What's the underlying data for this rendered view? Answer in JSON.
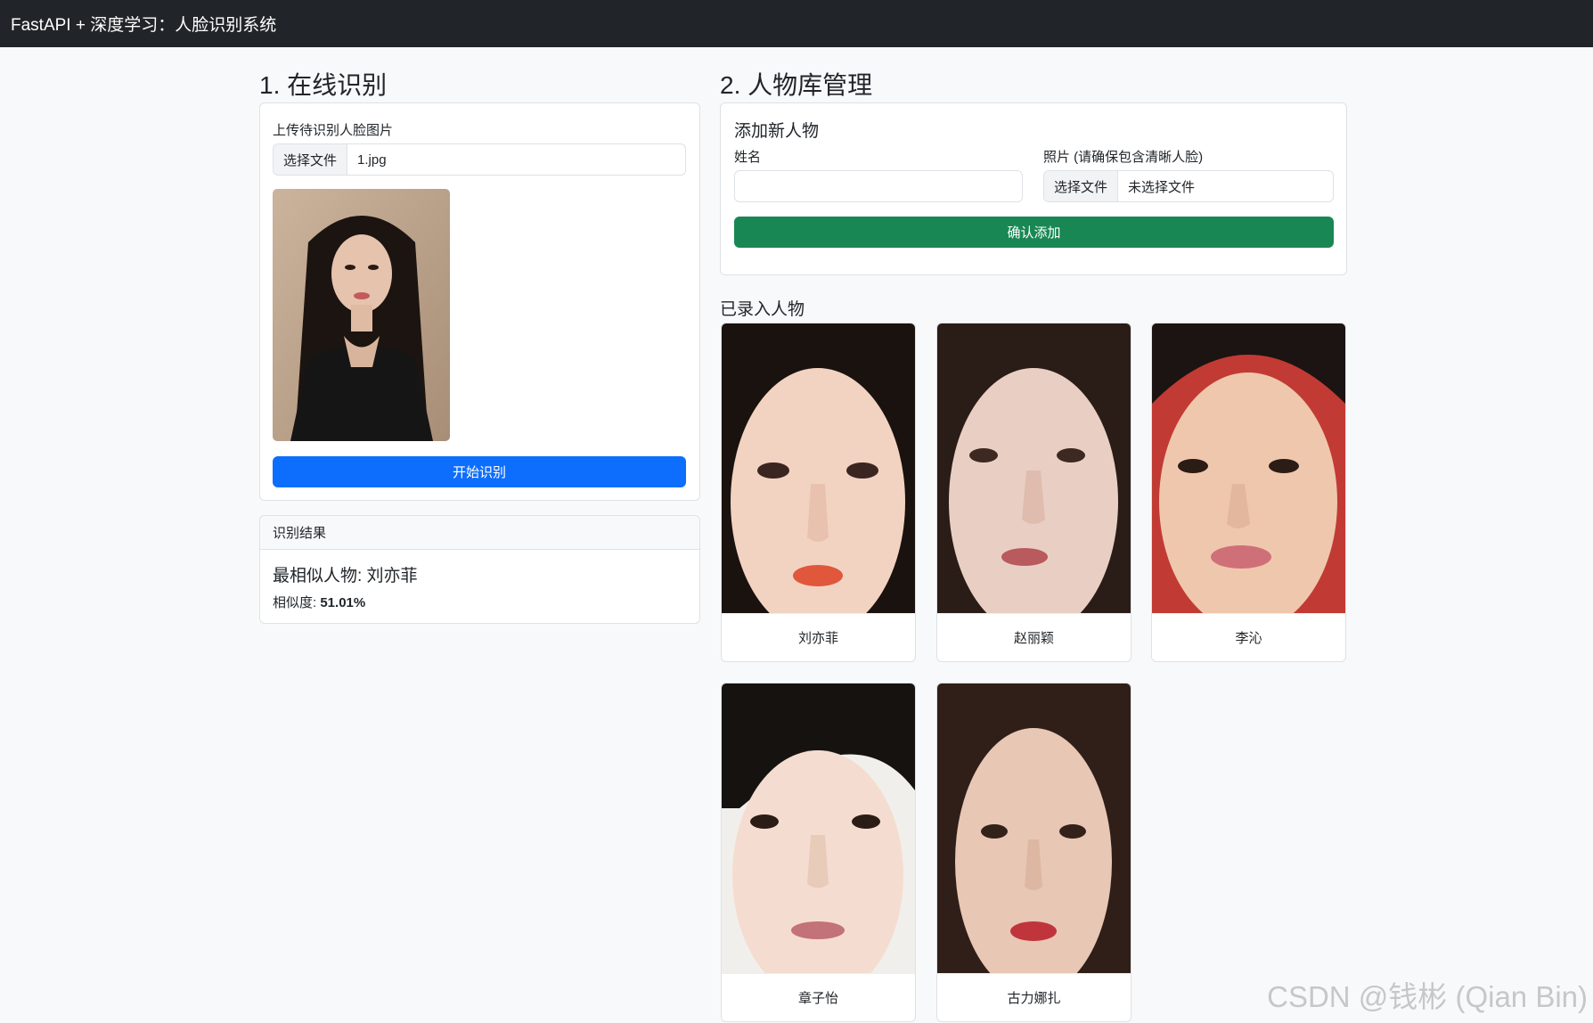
{
  "app": {
    "title": "FastAPI + 深度学习：人脸识别系统"
  },
  "recognition": {
    "section_title": "1. 在线识别",
    "upload_label": "上传待识别人脸图片",
    "file_button": "选择文件",
    "file_name": "1.jpg",
    "start_button": "开始识别",
    "result_header": "识别结果",
    "result_person_label": "最相似人物: 刘亦菲",
    "similarity_label": "相似度: ",
    "similarity_value": "51.01%"
  },
  "library": {
    "section_title": "2. 人物库管理",
    "add_title": "添加新人物",
    "name_label": "姓名",
    "name_value": "",
    "photo_label": "照片 (请确保包含清晰人脸)",
    "file_button": "选择文件",
    "file_name": "未选择文件",
    "confirm_button": "确认添加",
    "registered_title": "已录入人物",
    "people": [
      {
        "name": "刘亦菲"
      },
      {
        "name": "赵丽颖"
      },
      {
        "name": "李沁"
      },
      {
        "name": "章子怡"
      },
      {
        "name": "古力娜扎"
      }
    ]
  },
  "watermark": "CSDN @钱彬 (Qian Bin)",
  "colors": {
    "navbar": "#212529",
    "primary": "#0d6efd",
    "success": "#198754",
    "background": "#f8f9fa"
  }
}
